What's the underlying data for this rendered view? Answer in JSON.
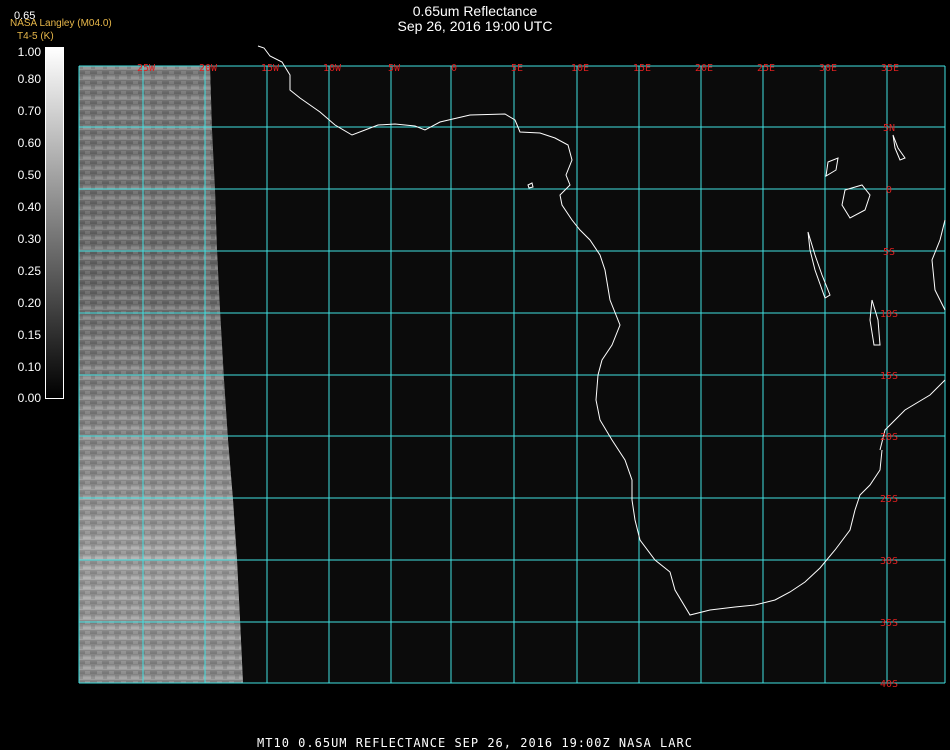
{
  "title": {
    "line1": "0.65um Reflectance",
    "line2": "Sep 26, 2016 19:00 UTC"
  },
  "provider": "NASA Langley (M04.0)",
  "variable_label": "T4-5 (K)",
  "colorbar": {
    "top_label": "0.65",
    "ticks": [
      "1.00",
      "0.80",
      "0.70",
      "0.60",
      "0.50",
      "0.40",
      "0.30",
      "0.25",
      "0.20",
      "0.15",
      "0.10",
      "0.00"
    ]
  },
  "map": {
    "lon_labels": [
      "25W",
      "20W",
      "15W",
      "10W",
      "5W",
      "0",
      "5E",
      "10E",
      "15E",
      "20E",
      "25E",
      "30E",
      "35E"
    ],
    "lat_labels": [
      "5N",
      "0",
      "5S",
      "10S",
      "15S",
      "20S",
      "25S",
      "30S",
      "35S",
      "40S"
    ],
    "grid_color": "#40e0e0",
    "label_color": "#e02020",
    "coast_color": "#ffffff"
  },
  "footer": "MT10  0.65UM REFLECTANCE   SEP 26, 2016 19:00Z   NASA LARC"
}
